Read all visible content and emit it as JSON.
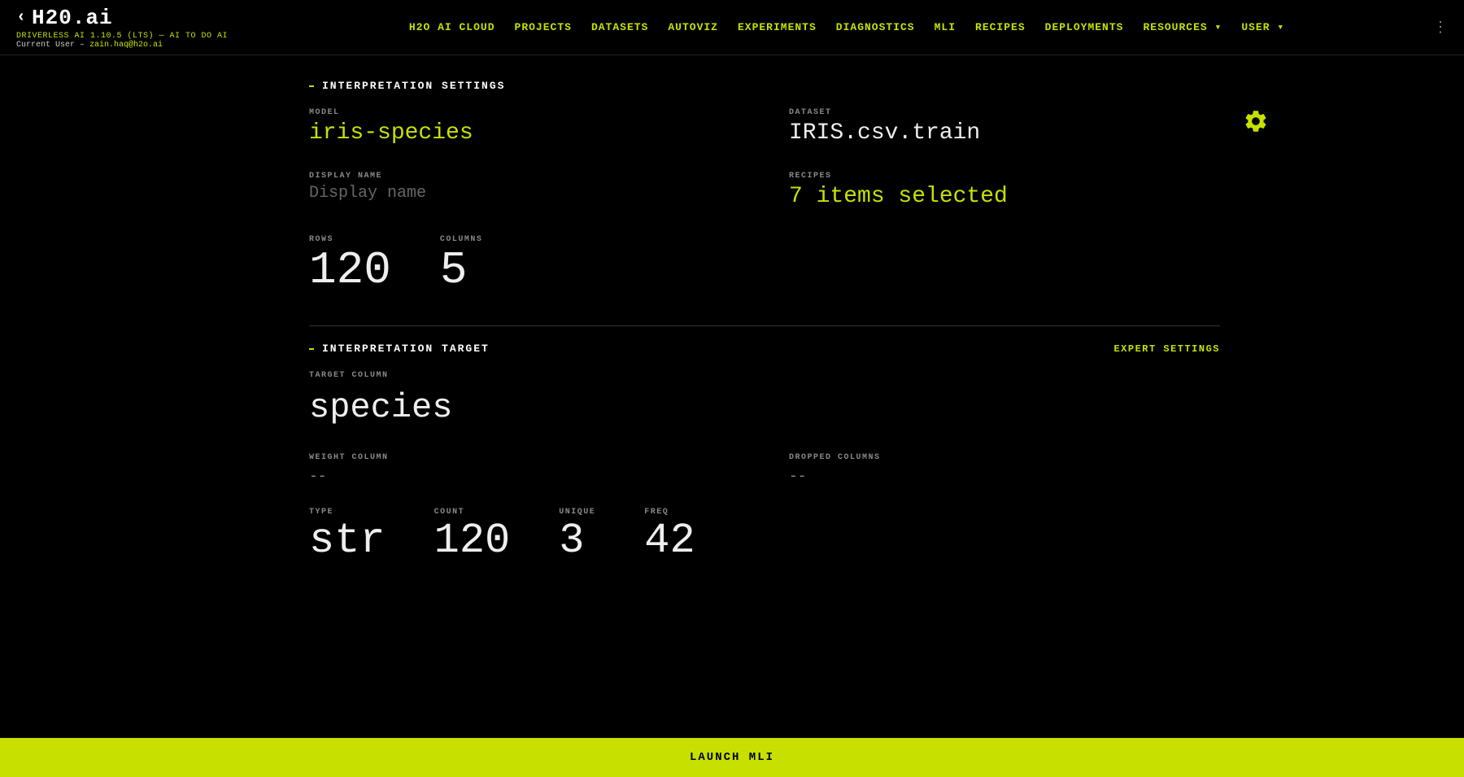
{
  "nav": {
    "logo": "H20.ai",
    "version": "DRIVERLESS AI 1.10.5 (LTS)",
    "version_suffix": "— AI TO DO AI",
    "current_user_label": "Current User –",
    "current_user_email": "zain.haq@h2o.ai",
    "links": [
      {
        "label": "H2O AI CLOUD",
        "id": "h2o-ai-cloud"
      },
      {
        "label": "PROJECTS",
        "id": "projects"
      },
      {
        "label": "DATASETS",
        "id": "datasets"
      },
      {
        "label": "AUTOVIZ",
        "id": "autoviz"
      },
      {
        "label": "EXPERIMENTS",
        "id": "experiments"
      },
      {
        "label": "DIAGNOSTICS",
        "id": "diagnostics"
      },
      {
        "label": "MLI",
        "id": "mli"
      },
      {
        "label": "RECIPES",
        "id": "recipes"
      },
      {
        "label": "DEPLOYMENTS",
        "id": "deployments"
      },
      {
        "label": "RESOURCES",
        "id": "resources"
      },
      {
        "label": "USER",
        "id": "user"
      }
    ]
  },
  "interpretation_settings": {
    "section_title": "INTERPRETATION SETTINGS",
    "model_label": "MODEL",
    "model_value": "iris-species",
    "dataset_label": "DATASET",
    "dataset_value": "IRIS.csv.train",
    "display_name_label": "DISPLAY NAME",
    "display_name_placeholder": "Display name",
    "recipes_label": "RECIPES",
    "recipes_value": "7 items selected",
    "rows_label": "ROWS",
    "rows_value": "120",
    "columns_label": "COLUMNS",
    "columns_value": "5"
  },
  "interpretation_target": {
    "section_title": "INTERPRETATION TARGET",
    "expert_settings_label": "EXPERT SETTINGS",
    "target_column_label": "TARGET COLUMN",
    "target_column_value": "species",
    "weight_column_label": "WEIGHT COLUMN",
    "weight_column_value": "--",
    "dropped_columns_label": "DROPPED COLUMNS",
    "dropped_columns_value": "--",
    "type_label": "TYPE",
    "type_value": "str",
    "count_label": "COUNT",
    "count_value": "120",
    "unique_label": "UNIQUE",
    "unique_value": "3",
    "freq_label": "FREQ",
    "freq_value": "42"
  },
  "launch_btn_label": "LAUNCH MLI"
}
